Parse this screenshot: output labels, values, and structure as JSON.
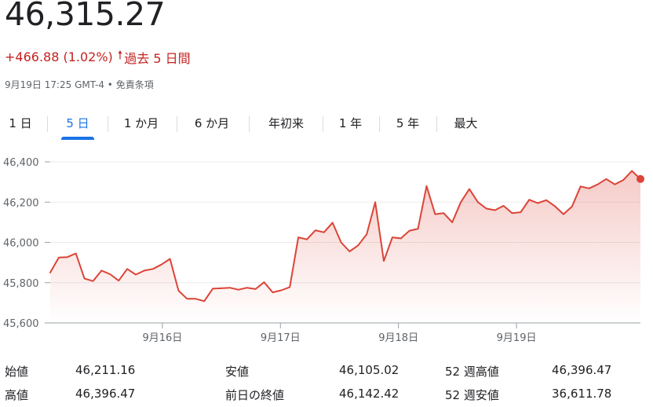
{
  "quote": {
    "price": "46,315.27",
    "change": "+466.88 (1.02%)",
    "period": "過去 5 日間",
    "timestamp": "9月19日 17:25 GMT-4",
    "disclaimer": "免責条項"
  },
  "tabs": [
    {
      "label": "1 日",
      "active": false
    },
    {
      "label": "5 日",
      "active": true
    },
    {
      "label": "1 か月",
      "active": false
    },
    {
      "label": "6 か月",
      "active": false
    },
    {
      "label": "年初来",
      "active": false
    },
    {
      "label": "1 年",
      "active": false
    },
    {
      "label": "5 年",
      "active": false
    },
    {
      "label": "最大",
      "active": false
    }
  ],
  "colors": {
    "line": "#db4437",
    "accent": "#1a73e8",
    "negative_text": "#c5221f"
  },
  "chart_data": {
    "type": "line",
    "ylim": [
      45600,
      46400
    ],
    "yticks": [
      45600,
      45800,
      46000,
      46200,
      46400
    ],
    "ytick_labels": [
      "45,600",
      "45,800",
      "46,000",
      "46,200",
      "46,400"
    ],
    "xticks": [
      9.5,
      19.5,
      29.5,
      39.5
    ],
    "xtick_labels": [
      "9月16日",
      "9月17日",
      "9月18日",
      "9月19日"
    ],
    "x_range": [
      0,
      50
    ],
    "grid": true,
    "values": [
      45850,
      45925,
      45927,
      45945,
      45820,
      45808,
      45860,
      45842,
      45810,
      45868,
      45840,
      45860,
      45868,
      45890,
      45918,
      45760,
      45720,
      45720,
      45708,
      45770,
      45772,
      45775,
      45765,
      45775,
      45768,
      45802,
      45752,
      45762,
      45778,
      46025,
      46015,
      46060,
      46050,
      46098,
      46000,
      45955,
      45985,
      46040,
      46200,
      45908,
      46025,
      46020,
      46058,
      46068,
      46280,
      46140,
      46145,
      46100,
      46200,
      46265,
      46200,
      46168,
      46160,
      46182,
      46145,
      46150,
      46212,
      46195,
      46210,
      46180,
      46140,
      46178,
      46278,
      46268,
      46288,
      46315,
      46288,
      46310,
      46355,
      46315
    ]
  },
  "stats": [
    {
      "label": "始値",
      "value": "46,211.16"
    },
    {
      "label": "高値",
      "value": "46,396.47"
    },
    {
      "label": "安値",
      "value": "46,105.02"
    },
    {
      "label": "前日の終値",
      "value": "46,142.42"
    },
    {
      "label": "52 週高値",
      "value": "46,396.47"
    },
    {
      "label": "52 週安値",
      "value": "36,611.78"
    }
  ]
}
